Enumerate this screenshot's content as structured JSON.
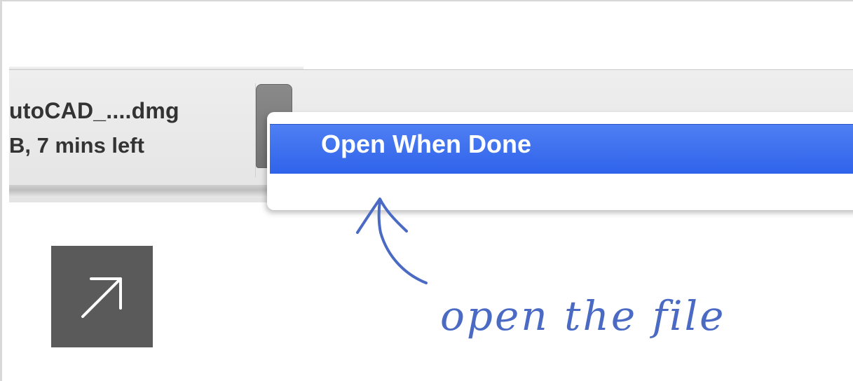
{
  "download": {
    "file_name": "utoCAD_....dmg",
    "status": "B, 7 mins left"
  },
  "context_menu": {
    "items": [
      {
        "label": "Open When Done",
        "highlighted": true
      }
    ]
  },
  "annotation": {
    "text": "open the file"
  },
  "icons": {
    "external_link": "arrow-up-right-icon",
    "options": "chevron-button"
  },
  "colors": {
    "menu_highlight": "#3568ee",
    "annotation": "#4a6ac4",
    "link_box": "#5a5a5a"
  }
}
